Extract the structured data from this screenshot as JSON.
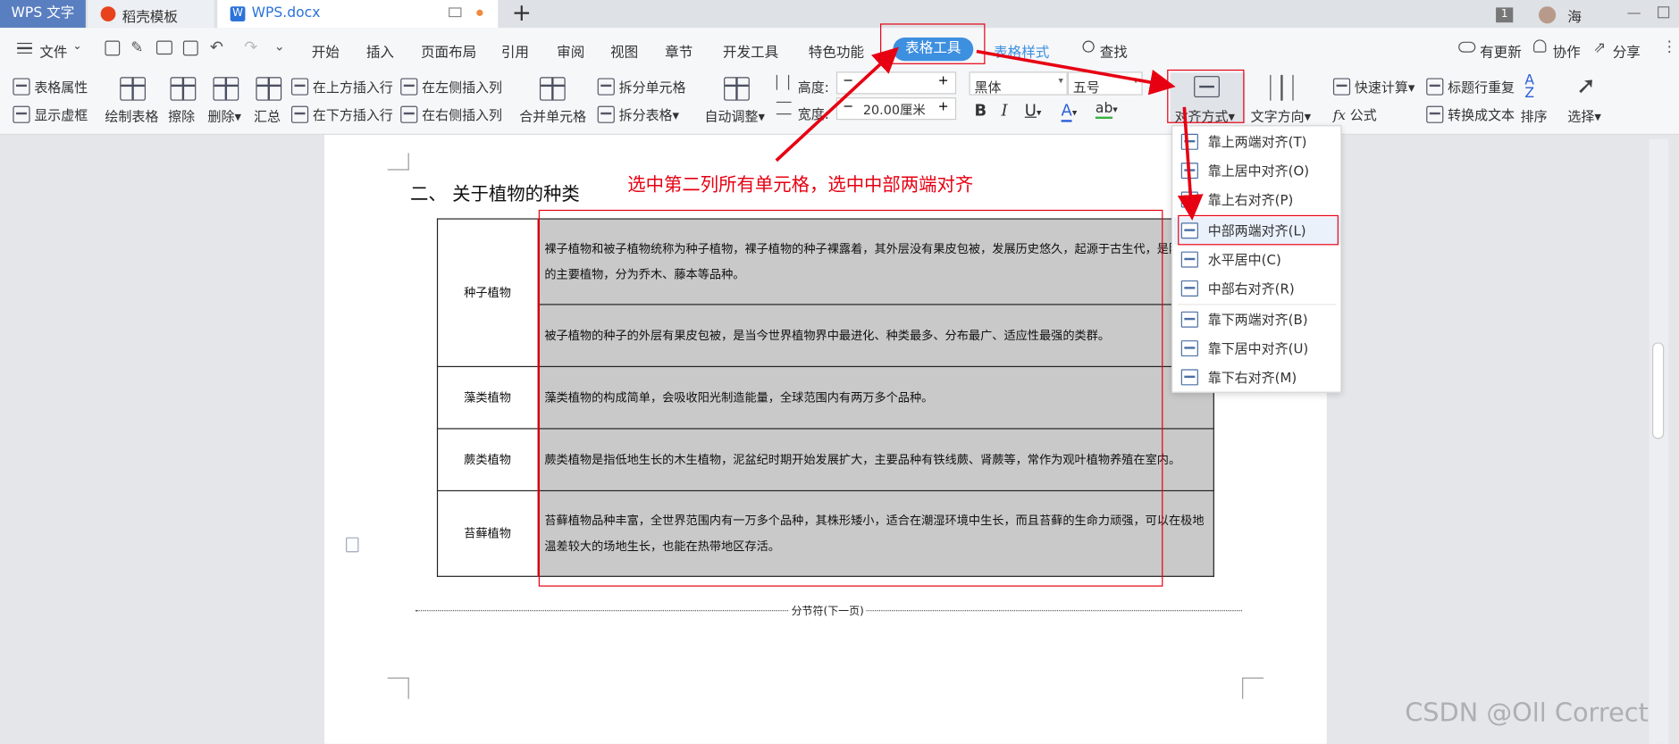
{
  "titlebar": {
    "app_tab": "WPS 文字",
    "tab2": "稻壳模板",
    "tab3": "WPS.docx",
    "new_tab": "+",
    "badge": "1",
    "user": "海"
  },
  "menu": {
    "file": "文件",
    "items": [
      "开始",
      "插入",
      "页面布局",
      "引用",
      "审阅",
      "视图",
      "章节",
      "开发工具",
      "特色功能"
    ],
    "active_tab": "表格工具",
    "table_style": "表格样式",
    "find": "查找",
    "update": "有更新",
    "collab": "协作",
    "share": "分享"
  },
  "ribbon": {
    "table_props": "表格属性",
    "show_grid": "显示虚框",
    "draw_table": "绘制表格",
    "erase": "擦除",
    "delete": "删除",
    "summary": "汇总",
    "insert_above": "在上方插入行",
    "insert_below": "在下方插入行",
    "insert_left": "在左侧插入列",
    "insert_right": "在右侧插入列",
    "merge_cells": "合并单元格",
    "split_cell": "拆分单元格",
    "split_table": "拆分表格",
    "auto_fit": "自动调整",
    "height_label": "高度:",
    "width_label": "宽度:",
    "width_value": "20.00厘米",
    "font_name": "黑体",
    "font_size": "五号",
    "bold": "B",
    "italic": "I",
    "underline": "U",
    "font_color": "A",
    "highlight": "ab",
    "align": "对齐方式",
    "text_dir": "文字方向",
    "quick_calc": "快速计算",
    "formula": "公式",
    "repeat_header": "标题行重复",
    "to_text": "转换成文本",
    "sort": "排序",
    "select": "选择"
  },
  "align_menu": {
    "items": [
      "靠上两端对齐(T)",
      "靠上居中对齐(O)",
      "靠上右对齐(P)",
      "中部两端对齐(L)",
      "水平居中(C)",
      "中部右对齐(R)",
      "靠下两端对齐(B)",
      "靠下居中对齐(U)",
      "靠下右对齐(M)"
    ],
    "highlighted": "中部两端对齐(L)"
  },
  "document": {
    "heading": "二、 关于植物的种类",
    "annotation": "选中第二列所有单元格，选中中部两端对齐",
    "rows": [
      {
        "name": "种子植物",
        "text": "裸子植物和被子植物统称为种子植物，裸子植物的种子裸露着，其外层没有果皮包被，发展历史悠久，起源于古生代，是陆地上的主要植物，分为乔木、藤本等品种。"
      },
      {
        "name": "",
        "text": "被子植物的种子的外层有果皮包被，是当今世界植物界中最进化、种类最多、分布最广、适应性最强的类群。"
      },
      {
        "name": "藻类植物",
        "text": "藻类植物的构成简单，会吸收阳光制造能量，全球范围内有两万多个品种。"
      },
      {
        "name": "蕨类植物",
        "text": "蕨类植物是指低地生长的木生植物，泥盆纪时期开始发展扩大，主要品种有铁线蕨、肾蕨等，常作为观叶植物养殖在室内。"
      },
      {
        "name": "苔藓植物",
        "text": "苔藓植物品种丰富，全世界范围内有一万多个品种，其株形矮小，适合在潮湿环境中生长，而且苔藓的生命力顽强，可以在极地温差较大的场地生长，也能在热带地区存活。"
      }
    ],
    "section_break": "分节符(下一页)"
  },
  "watermark": "CSDN @Oll Correct",
  "colors": {
    "accent": "#3d8fe0",
    "annotation_red": "#e60012",
    "title_tab_blue": "#5a7fc0"
  }
}
